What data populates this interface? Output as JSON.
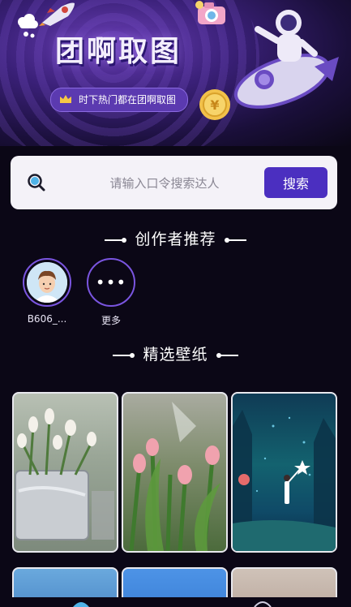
{
  "banner": {
    "title": "团啊取图",
    "subtitle": "时下热门都在团啊取图"
  },
  "search": {
    "placeholder": "请输入口令搜索达人",
    "button_label": "搜索"
  },
  "sections": {
    "creators_title": "创作者推荐",
    "wallpapers_title": "精选壁纸"
  },
  "creators": [
    {
      "name": "B606_..."
    },
    {
      "name": "更多",
      "icon": "more-dots-icon",
      "glyph": "•••"
    }
  ],
  "wallpapers": [
    {
      "subject": "tulips-in-silver-vase"
    },
    {
      "subject": "tulips-closeup"
    },
    {
      "subject": "starry-forest-girl"
    },
    {
      "subject": "blue-sky"
    },
    {
      "subject": "blue-wallpaper"
    },
    {
      "subject": "sunset-sky"
    }
  ],
  "colors": {
    "background": "#0b0716",
    "accent": "#4b2fc0",
    "ring": "#7a55e0"
  }
}
